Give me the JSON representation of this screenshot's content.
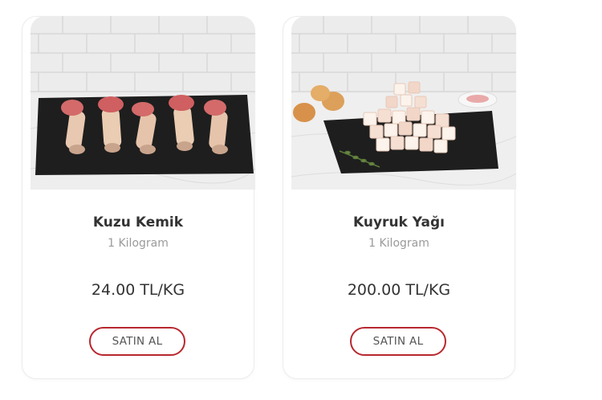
{
  "products": [
    {
      "title": "Kuzu Kemik",
      "unit": "1 Kilogram",
      "price": "24.00 TL/KG",
      "button_label": "SATIN AL"
    },
    {
      "title": "Kuyruk Yağı",
      "unit": "1 Kilogram",
      "price": "200.00 TL/KG",
      "button_label": "SATIN AL"
    }
  ],
  "colors": {
    "button_border": "#b8282f",
    "title_text": "#333333",
    "subtitle_text": "#9a9a9a"
  }
}
